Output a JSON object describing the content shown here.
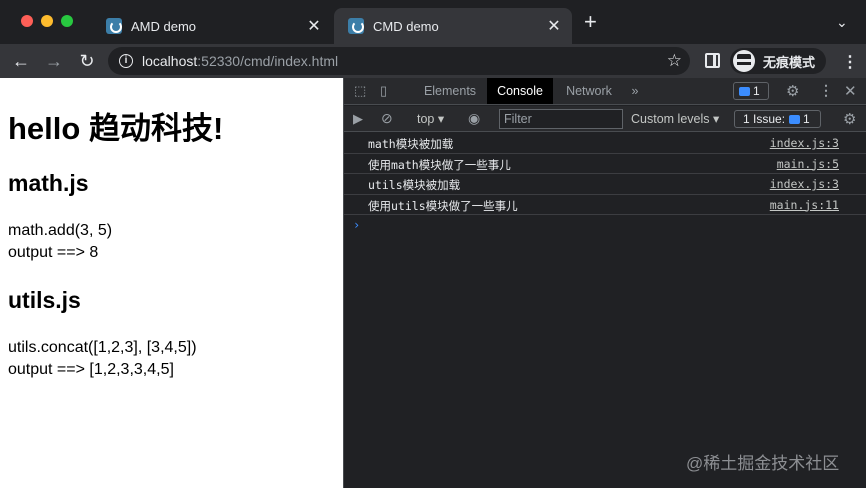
{
  "tabs": [
    {
      "title": "AMD demo",
      "close": "✕"
    },
    {
      "title": "CMD demo",
      "close": "✕"
    }
  ],
  "new_tab": "+",
  "tab_menu": "⌄",
  "toolbar": {
    "back": "←",
    "forward": "→",
    "reload": "↻",
    "url_host": "localhost",
    "url_rest": ":52330/cmd/index.html",
    "star": "☆",
    "incognito_label": "无痕模式",
    "menu": "⋮"
  },
  "page": {
    "heading": "hello 趋动科技!",
    "section1_title": "math.js",
    "section1_line1": "math.add(3, 5)",
    "section1_line2": "output ==> 8",
    "section2_title": "utils.js",
    "section2_line1": "utils.concat([1,2,3], [3,4,5])",
    "section2_line2": "output ==> [1,2,3,3,4,5]"
  },
  "devtools": {
    "tabs": [
      "Elements",
      "Console",
      "Network"
    ],
    "more_tabs": "»",
    "issue_count": "1",
    "context": "top",
    "filter_placeholder": "Filter",
    "levels": "Custom levels ▾",
    "issues_label": "1 Issue:",
    "issues_count": "1",
    "logs": [
      {
        "message": "math模块被加载",
        "source": "index.js:3"
      },
      {
        "message": "使用math模块做了一些事儿",
        "source": "main.js:5"
      },
      {
        "message": "utils模块被加载",
        "source": "index.js:3"
      },
      {
        "message": "使用utils模块做了一些事儿",
        "source": "main.js:11"
      }
    ],
    "prompt": "›"
  },
  "watermark": "@稀土掘金技术社区"
}
